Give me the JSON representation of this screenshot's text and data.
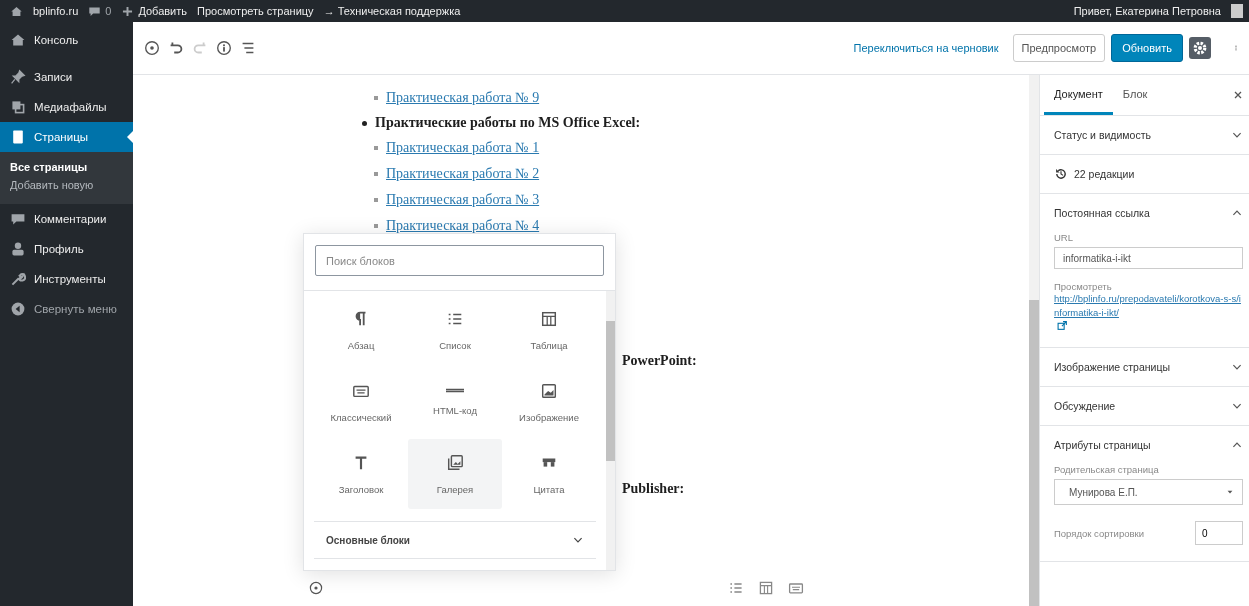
{
  "admin_bar": {
    "site": "bplinfo.ru",
    "comments": "0",
    "new": "Добавить",
    "links": [
      "Просмотреть страницу",
      "→ Техническая поддержка"
    ],
    "greeting": "Привет, Екатерина Петровна"
  },
  "sidebar": {
    "items": [
      {
        "kind": "dashboard",
        "label": "Консоль",
        "selected": false
      },
      {
        "kind": "pin",
        "label": "Записи",
        "selected": false
      },
      {
        "kind": "media",
        "label": "Медиафайлы",
        "selected": false
      },
      {
        "kind": "page",
        "label": "Страницы",
        "selected": true,
        "children": [
          {
            "label": "Все страницы",
            "selected": true
          },
          {
            "label": "Добавить новую",
            "selected": false
          }
        ]
      },
      {
        "kind": "comment",
        "label": "Комментарии",
        "selected": false
      },
      {
        "kind": "user",
        "label": "Профиль",
        "selected": false
      },
      {
        "kind": "wrench",
        "label": "Инструменты",
        "selected": false
      }
    ],
    "collapse": "Свернуть меню"
  },
  "toolbar": {
    "tools": [
      {
        "kind": "add",
        "disabled": false
      },
      {
        "kind": "undo",
        "disabled": false
      },
      {
        "kind": "redo",
        "disabled": true
      },
      {
        "kind": "info",
        "disabled": false
      },
      {
        "kind": "outline",
        "disabled": false
      }
    ],
    "draft_link": "Переключиться на черновик",
    "preview": "Предпросмотр",
    "update": "Обновить",
    "settings_on": true
  },
  "content": {
    "items": [
      {
        "kind": "link",
        "text": "Практическая работа № 9"
      },
      {
        "kind": "heading",
        "text": "Практические работы по MS Office Excel:"
      },
      {
        "kind": "link",
        "text": "Практическая работа № 1"
      },
      {
        "kind": "link",
        "text": "Практическая работа № 2"
      },
      {
        "kind": "link",
        "text": "Практическая работа № 3"
      },
      {
        "kind": "link",
        "text": "Практическая работа № 4"
      }
    ],
    "fragments": [
      "PowerPoint:",
      "Publisher:"
    ]
  },
  "inserter": {
    "search_placeholder": "Поиск блоков",
    "blocks": [
      {
        "kind": "paragraph",
        "label": "Абзац",
        "selected": false
      },
      {
        "kind": "list",
        "label": "Список",
        "selected": false
      },
      {
        "kind": "table",
        "label": "Таблица",
        "selected": false
      },
      {
        "kind": "classic",
        "label": "Классический",
        "selected": false
      },
      {
        "kind": "html",
        "label": "HTML-код",
        "selected": false
      },
      {
        "kind": "image",
        "label": "Изображение",
        "selected": false
      },
      {
        "kind": "heading",
        "label": "Заголовок",
        "selected": false
      },
      {
        "kind": "gallery",
        "label": "Галерея",
        "selected": true
      },
      {
        "kind": "quote",
        "label": "Цитата",
        "selected": false
      }
    ],
    "category": "Основные блоки",
    "category_expanded": false
  },
  "bottom_tools": [
    {
      "kind": "list"
    },
    {
      "kind": "table"
    },
    {
      "kind": "classic"
    }
  ],
  "settings_panel": {
    "tabs": [
      {
        "label": "Документ",
        "selected": true
      },
      {
        "label": "Блок",
        "selected": false
      }
    ],
    "sections": [
      {
        "kind": "panel",
        "title": "Статус и видимость",
        "expanded": false
      },
      {
        "kind": "revisions",
        "label": "22 редакции"
      },
      {
        "kind": "permalink",
        "title": "Постоянная ссылка",
        "expanded": true,
        "url_label": "URL",
        "url_value": "informatika-i-ikt",
        "view_label": "Просмотреть",
        "view_link": "http://bplinfo.ru/prepodavateli/korotkova-s-s/informatika-i-ikt/"
      },
      {
        "kind": "panel",
        "title": "Изображение страницы",
        "expanded": false
      },
      {
        "kind": "panel",
        "title": "Обсуждение",
        "expanded": false
      },
      {
        "kind": "attributes",
        "title": "Атрибуты страницы",
        "expanded": true,
        "parent_label": "Родительская страница",
        "parent_value": "Мунирова Е.П.",
        "order_label": "Порядок сортировки",
        "order_value": "0"
      }
    ]
  }
}
